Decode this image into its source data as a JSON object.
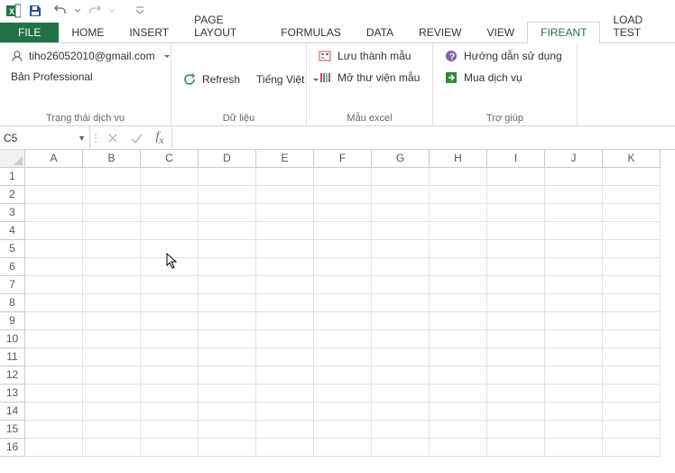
{
  "qat": {},
  "tabs": {
    "file": "FILE",
    "items": [
      "HOME",
      "INSERT",
      "PAGE LAYOUT",
      "FORMULAS",
      "DATA",
      "REVIEW",
      "VIEW",
      "FIREANT",
      "LOAD TEST"
    ],
    "active": "FIREANT"
  },
  "ribbon": {
    "group1": {
      "account": "tiho26052010@gmail.com",
      "plan": "Bản Professional",
      "title": "Trạng thái dịch vụ"
    },
    "group2": {
      "refresh": "Refresh",
      "lang": "Tiếng Việt",
      "title": "Dữ liệu"
    },
    "group3": {
      "save_template": "Lưu thành mẫu",
      "open_template": "Mở thư viện mẫu",
      "title": "Mẫu excel"
    },
    "group4": {
      "guide": "Hướng dẫn sử dụng",
      "buy": "Mua dịch vụ",
      "title": "Trợ giúp"
    }
  },
  "formula_bar": {
    "name_box": "C5",
    "formula": ""
  },
  "sheet": {
    "columns": [
      "A",
      "B",
      "C",
      "D",
      "E",
      "F",
      "G",
      "H",
      "I",
      "J",
      "K"
    ],
    "rows": [
      1,
      2,
      3,
      4,
      5,
      6,
      7,
      8,
      9,
      10,
      11,
      12,
      13,
      14,
      15,
      16
    ]
  }
}
